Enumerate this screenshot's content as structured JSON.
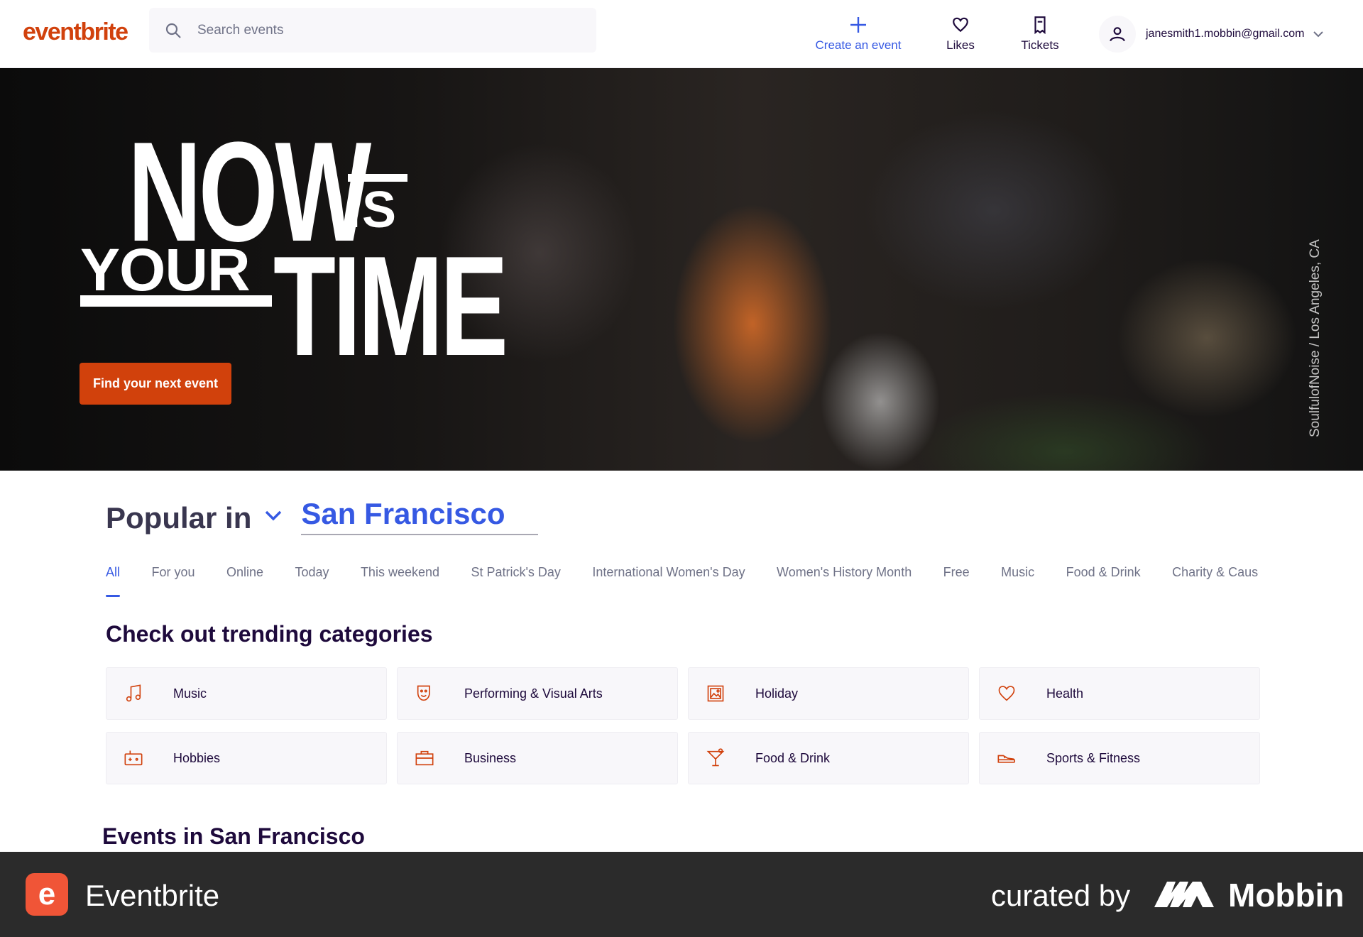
{
  "header": {
    "logo": "eventbrite",
    "search_placeholder": "Search events",
    "create_label": "Create an event",
    "likes_label": "Likes",
    "tickets_label": "Tickets",
    "account_email": "janesmith1.mobbin@gmail.com"
  },
  "hero": {
    "line_now": "NOW",
    "line_is": "IS",
    "line_your": "YOUR",
    "line_time": "TIME",
    "cta_label": "Find your next event",
    "photo_credit": "SoulfulofNoise / Los Angeles, CA"
  },
  "popular": {
    "label": "Popular in",
    "city": "San Francisco"
  },
  "tabs": [
    "All",
    "For you",
    "Online",
    "Today",
    "This weekend",
    "St Patrick's Day",
    "International Women's Day",
    "Women's History Month",
    "Free",
    "Music",
    "Food & Drink",
    "Charity & Causes"
  ],
  "categories_title": "Check out trending categories",
  "categories": [
    {
      "label": "Music",
      "icon": "music-note-icon"
    },
    {
      "label": "Performing & Visual Arts",
      "icon": "theater-mask-icon"
    },
    {
      "label": "Holiday",
      "icon": "photo-frame-icon"
    },
    {
      "label": "Health",
      "icon": "heart-icon"
    },
    {
      "label": "Hobbies",
      "icon": "game-controller-icon"
    },
    {
      "label": "Business",
      "icon": "briefcase-icon"
    },
    {
      "label": "Food & Drink",
      "icon": "cocktail-icon"
    },
    {
      "label": "Sports & Fitness",
      "icon": "sneaker-icon"
    }
  ],
  "events_title": "Events in San Francisco",
  "footer": {
    "app_icon_letter": "e",
    "app_name": "Eventbrite",
    "curated_by": "curated by",
    "mobbin": "Mobbin"
  },
  "colors": {
    "brand": "#d1410c",
    "accent": "#3659e3",
    "text": "#1e0a3c"
  }
}
